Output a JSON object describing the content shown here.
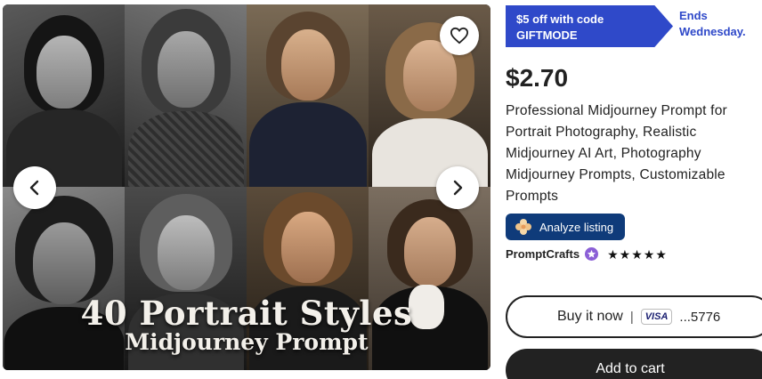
{
  "gallery": {
    "overlay_title": "40 Portrait Styles",
    "overlay_subtitle": "Midjourney Prompt",
    "favorite_icon": "heart-icon",
    "prev_icon": "chevron-left-icon",
    "next_icon": "chevron-right-icon"
  },
  "promo": {
    "line1": "$5 off with code",
    "line2": "GIFTMODE",
    "ends_line1": "Ends",
    "ends_line2": "Wednesday."
  },
  "price": "$2.70",
  "product_title": "Professional Midjourney Prompt for Portrait Photography, Realistic Midjourney AI Art, Photography Midjourney Prompts, Customizable Prompts",
  "analyze": {
    "label": "Analyze listing",
    "icon": "flower-icon"
  },
  "shop": {
    "name": "PromptCrafts",
    "badge_icon": "star-seller-icon",
    "rating_icon": "star-icon",
    "rating": 5
  },
  "buy_now": {
    "label": "Buy it now",
    "separator": "|",
    "card_brand": "VISA",
    "card_last": "...5776"
  },
  "add_to_cart": {
    "label": "Add to cart"
  },
  "colors": {
    "promo": "#2f49c9",
    "analyze": "#0f3b7a",
    "star_seller": "#8b5fd6",
    "cart": "#222222"
  }
}
